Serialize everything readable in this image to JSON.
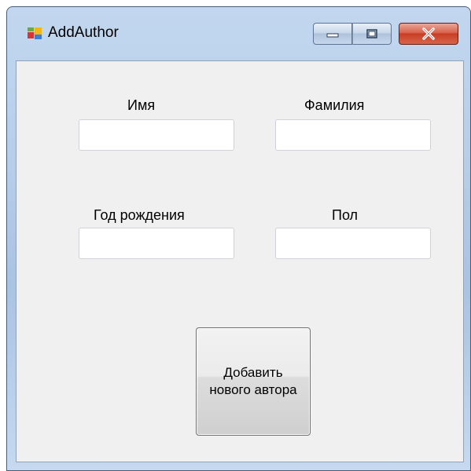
{
  "window": {
    "title": "AddAuthor"
  },
  "form": {
    "first_name_label": "Имя",
    "last_name_label": "Фамилия",
    "birth_year_label": "Год рождения",
    "gender_label": "Пол",
    "first_name_value": "",
    "last_name_value": "",
    "birth_year_value": "",
    "gender_value": "",
    "submit_label": "Добавить нового автора"
  },
  "icons": {
    "app": "form-icon",
    "minimize": "minimize-icon",
    "maximize": "maximize-icon",
    "close": "close-icon"
  },
  "colors": {
    "close_button": "#c73e24",
    "client_background": "#f0f0f0",
    "frame": "#b7cde8"
  }
}
